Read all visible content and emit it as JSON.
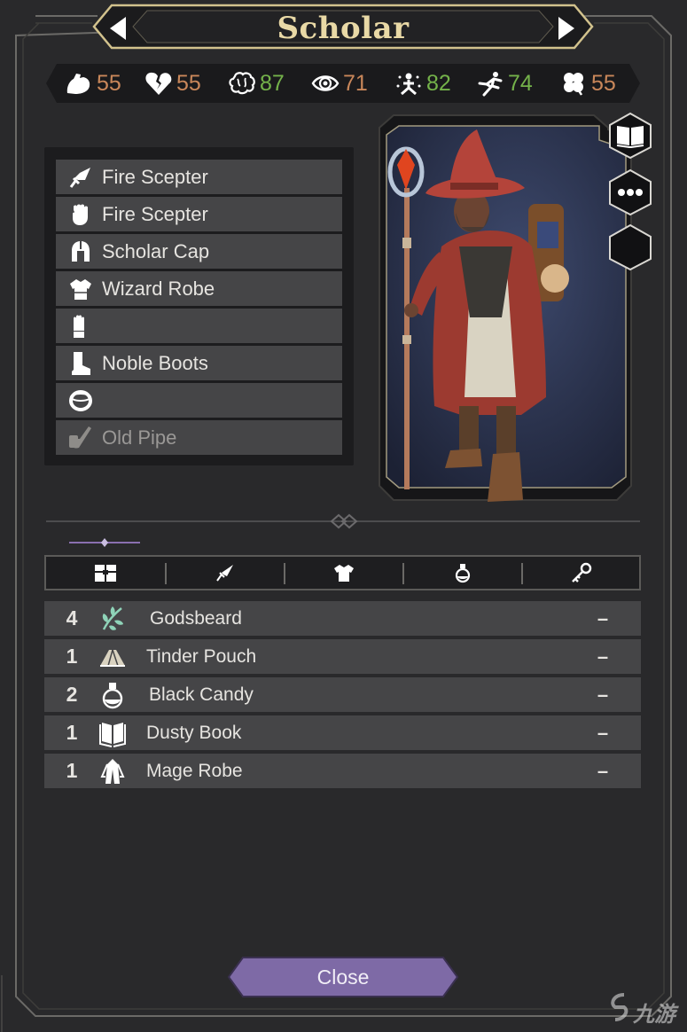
{
  "header": {
    "title": "Scholar"
  },
  "stats": [
    {
      "icon": "strength-icon",
      "value": "55",
      "color": "#c9875a"
    },
    {
      "icon": "broken-heart-icon",
      "value": "55",
      "color": "#c9875a"
    },
    {
      "icon": "brain-icon",
      "value": "87",
      "color": "#74b24a"
    },
    {
      "icon": "eye-icon",
      "value": "71",
      "color": "#c9875a"
    },
    {
      "icon": "spirit-icon",
      "value": "82",
      "color": "#74b24a"
    },
    {
      "icon": "runner-icon",
      "value": "74",
      "color": "#74b24a"
    },
    {
      "icon": "clover-icon",
      "value": "55",
      "color": "#c9875a"
    }
  ],
  "equipment": [
    {
      "slot": "weapon",
      "icon": "sword-icon",
      "label": "Fire Scepter"
    },
    {
      "slot": "offhand",
      "icon": "fist-icon",
      "label": "Fire Scepter"
    },
    {
      "slot": "head",
      "icon": "helmet-icon",
      "label": "Scholar Cap"
    },
    {
      "slot": "body",
      "icon": "armor-icon",
      "label": "Wizard Robe"
    },
    {
      "slot": "hands",
      "icon": "glove-icon",
      "label": ""
    },
    {
      "slot": "feet",
      "icon": "boot-icon",
      "label": "Noble Boots"
    },
    {
      "slot": "ring",
      "icon": "ring-icon",
      "label": ""
    },
    {
      "slot": "trinket",
      "icon": "pipe-icon",
      "label": "Old Pipe"
    }
  ],
  "side_buttons": [
    "book-icon",
    "more-icon",
    "empty-slot"
  ],
  "tabs": [
    {
      "icon": "chest-icon"
    },
    {
      "icon": "sword-icon"
    },
    {
      "icon": "armor-icon"
    },
    {
      "icon": "potion-icon"
    },
    {
      "icon": "key-icon"
    }
  ],
  "inventory": [
    {
      "qty": "4",
      "icon": "herb-icon",
      "name": "Godsbeard",
      "action": "–"
    },
    {
      "qty": "1",
      "icon": "tent-icon",
      "name": "Tinder Pouch",
      "action": "–"
    },
    {
      "qty": "2",
      "icon": "potion-icon",
      "name": "Black Candy",
      "action": "–"
    },
    {
      "qty": "1",
      "icon": "book-icon",
      "name": "Dusty Book",
      "action": "–"
    },
    {
      "qty": "1",
      "icon": "robe-icon",
      "name": "Mage Robe",
      "action": "–"
    }
  ],
  "close_label": "Close",
  "watermark": "九游"
}
